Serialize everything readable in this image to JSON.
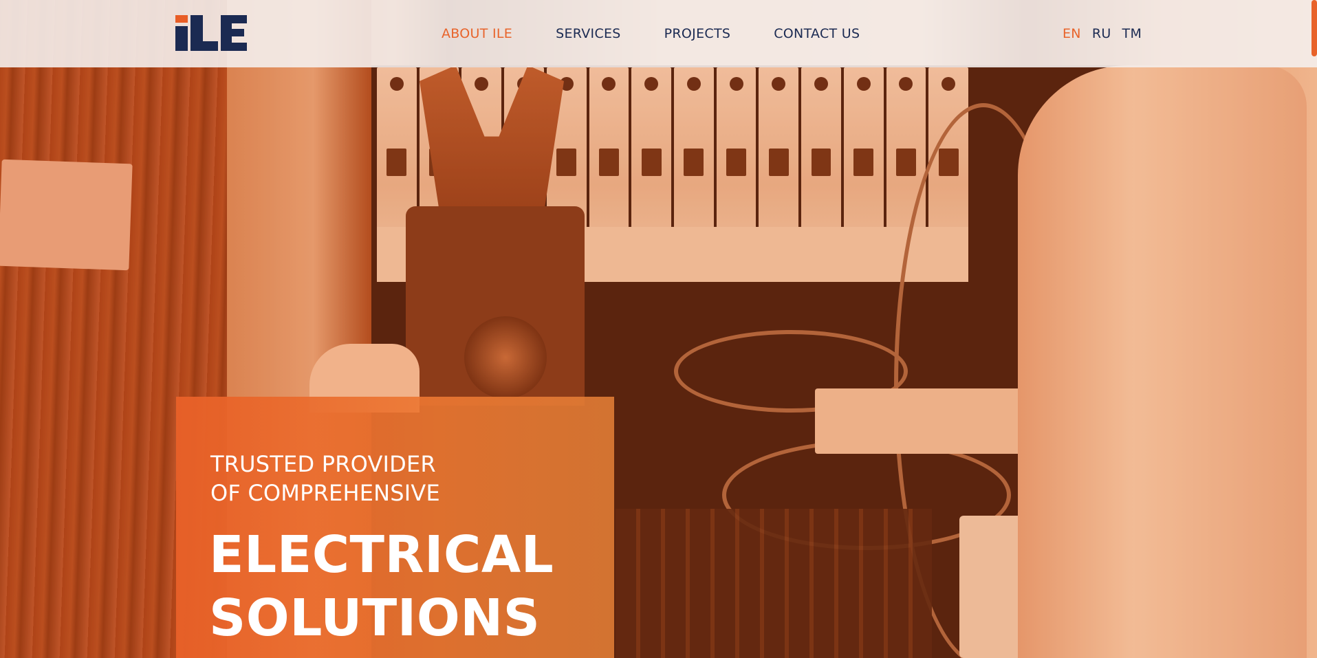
{
  "brand": {
    "logo_text": "ILE",
    "colors": {
      "navy": "#1b2a52",
      "accent": "#e8632a"
    }
  },
  "nav": {
    "items": [
      {
        "label": "ABOUT ILE",
        "active": true
      },
      {
        "label": "SERVICES",
        "active": false
      },
      {
        "label": "PROJECTS",
        "active": false
      },
      {
        "label": "CONTACT US",
        "active": false
      }
    ]
  },
  "languages": [
    {
      "label": "EN",
      "active": true
    },
    {
      "label": "RU",
      "active": false
    },
    {
      "label": "TM",
      "active": false
    }
  ],
  "hero": {
    "background_image": "electrician-clamp-meter-panel-photo",
    "subtitle_line1": "TRUSTED PROVIDER",
    "subtitle_line2": "OF COMPREHENSIVE",
    "title_line1": "ELECTRICAL",
    "title_line2": "SOLUTIONS"
  }
}
